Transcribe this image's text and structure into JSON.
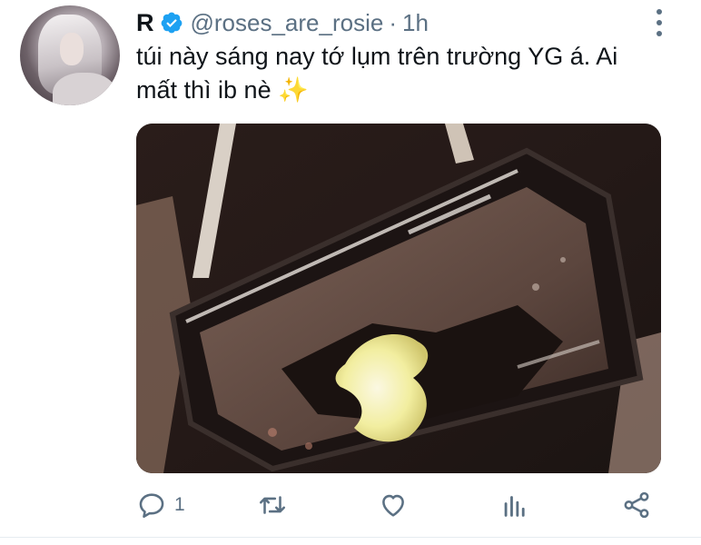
{
  "tweet": {
    "name": "R",
    "handle": "@roses_are_rosie",
    "separator": "·",
    "time": "1h",
    "text": "túi này sáng nay tớ lụm trên trường YG á. Ai\nmất thì ib nè ✨",
    "image_alt": "Photo of a dark clear bag with yellow item inside"
  },
  "actions": {
    "reply_count": "1",
    "retweet_count": "",
    "like_count": ""
  },
  "colors": {
    "verified": "#1da1f2",
    "secondary_text": "#5b7083",
    "icon": "#5b7083"
  },
  "icons": [
    "more-vertical-icon",
    "verified-badge-icon",
    "reply-icon",
    "retweet-icon",
    "like-icon",
    "analytics-icon",
    "share-icon"
  ]
}
